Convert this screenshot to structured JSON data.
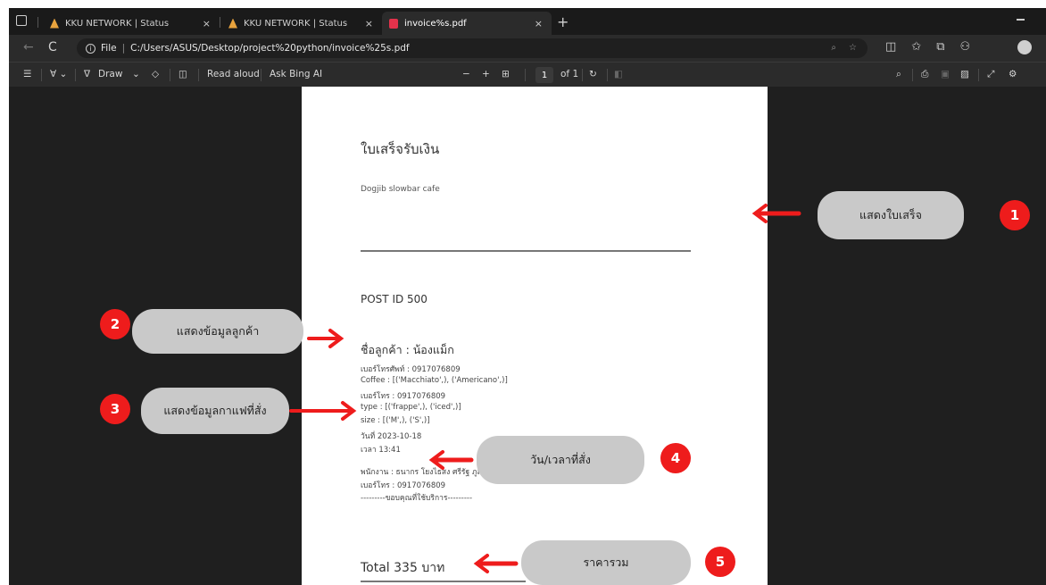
{
  "browser": {
    "tabs": [
      {
        "title": "KKU NETWORK | Status",
        "close": "×",
        "active": false
      },
      {
        "title": "KKU NETWORK | Status",
        "close": "×",
        "active": false
      },
      {
        "title": "invoice%s.pdf",
        "close": "×",
        "active": true
      }
    ],
    "new_tab": "+",
    "address": {
      "scheme": "File",
      "url": "C:/Users/ASUS/Desktop/project%20python/invoice%25s.pdf"
    }
  },
  "pdf_toolbar": {
    "draw_label": "Draw",
    "read_aloud": "Read aloud",
    "ask_bing": "Ask Bing AI",
    "zoom_out": "−",
    "zoom_in": "+",
    "page_current": "1",
    "page_total": "of 1"
  },
  "receipt": {
    "title": "ใบเสร็จรับเงิน",
    "shop": "Dogjib slowbar cafe",
    "post_id": "POST ID 500",
    "customer": "ชื่อลูกค้า : น้องแม็ก",
    "lines_a": [
      "เบอร์โทรศัพท์ : 0917076809",
      "Coffee : [('Macchiato',), ('Americano',)]",
      "เบอร์โทร : 0917076809",
      "type : [('frappe',), ('iced',)]",
      "size : [('M',), ('S',)]",
      "วันที่ 2023-10-18",
      "เวลา 13:41"
    ],
    "lines_b": [
      "พนักงาน : ธนากร โยงไธสง ศรีรัฐ ภูสถาน",
      "เบอร์โทร : 0917076809",
      "---------ขอบคุณที่ใช้บริการ---------"
    ],
    "total": "Total 335 บาท"
  },
  "annotations": [
    {
      "number": "1",
      "label": "แสดงใบเสร็จ"
    },
    {
      "number": "2",
      "label": "แสดงข้อมูลลูกค้า"
    },
    {
      "number": "3",
      "label": "แสดงข้อมูลกาแฟที่สั่ง"
    },
    {
      "number": "4",
      "label": "วัน/เวลาที่สั่ง"
    },
    {
      "number": "5",
      "label": "ราคารวม"
    }
  ],
  "colors": {
    "annotation_red": "#ee1c1c",
    "pill_gray": "#c9c9c9",
    "chrome_dark": "#2b2b2b"
  }
}
